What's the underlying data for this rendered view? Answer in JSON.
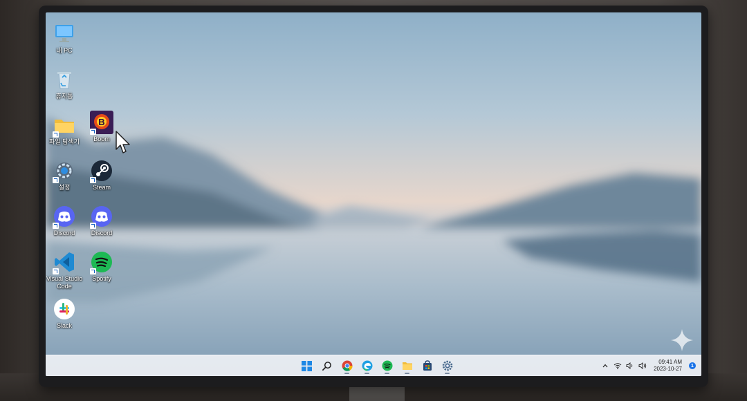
{
  "desktop": {
    "icons": [
      {
        "id": "this-pc",
        "label": "내 PC"
      },
      {
        "id": "recycle-bin",
        "label": "휴지통"
      },
      {
        "id": "file-explorer",
        "label": "파일 탐색기"
      },
      {
        "id": "boom",
        "label": "Boom"
      },
      {
        "id": "settings",
        "label": "설정"
      },
      {
        "id": "steam",
        "label": "Steam"
      },
      {
        "id": "discord-1",
        "label": "Discord"
      },
      {
        "id": "discord-2",
        "label": "Discord"
      },
      {
        "id": "vscode",
        "label": "Visual Studio Code"
      },
      {
        "id": "spotify",
        "label": "Spotify"
      },
      {
        "id": "slack",
        "label": "Slack"
      }
    ]
  },
  "taskbar": {
    "apps": [
      "windows-start-icon",
      "search-icon",
      "chrome-icon",
      "edge-icon",
      "spotify-icon",
      "file-explorer-icon",
      "microsoft-store-icon",
      "settings-icon"
    ],
    "tray": {
      "icons": [
        "chevron-up-icon",
        "wifi-icon",
        "speaker-icon",
        "volume-icon"
      ],
      "time": "09:41 AM",
      "date": "2023-10-27",
      "notification_count": "1"
    }
  },
  "colors": {
    "accent": "#1a73e8",
    "discord": "#5865f2",
    "spotify": "#1db954",
    "vscode": "#1f8ad2",
    "steam": "#1b2838"
  }
}
